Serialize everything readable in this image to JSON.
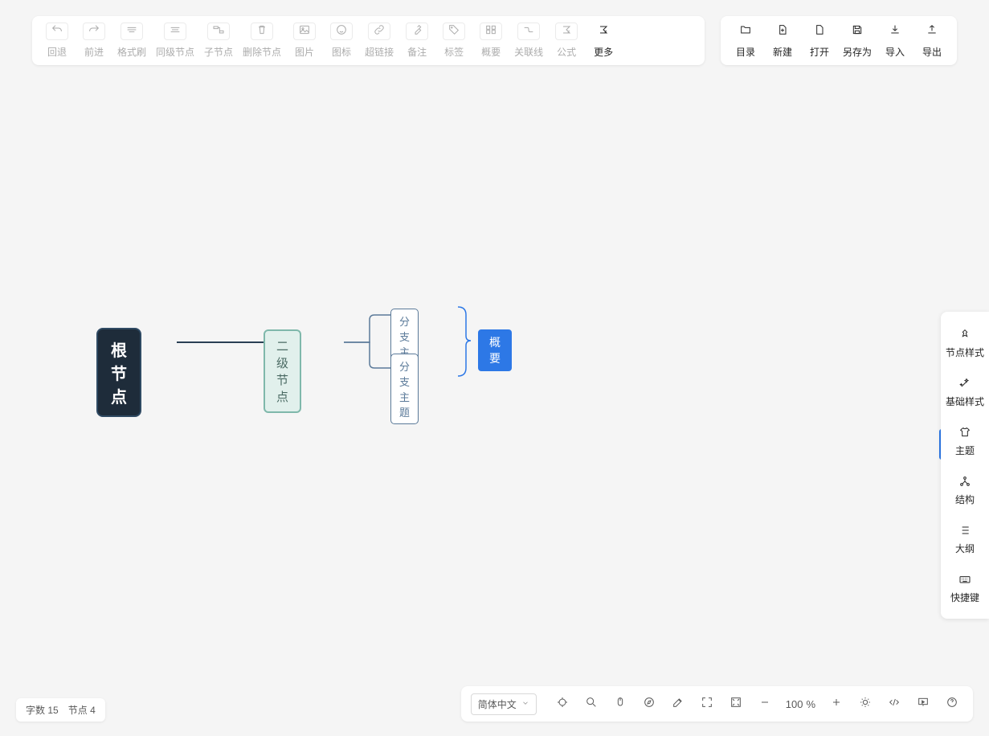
{
  "toolbar": {
    "undo": "回退",
    "redo": "前进",
    "format_painter": "格式刷",
    "sibling_node": "同级节点",
    "child_node": "子节点",
    "delete_node": "删除节点",
    "image": "图片",
    "icon": "图标",
    "hyperlink": "超链接",
    "note": "备注",
    "tag": "标签",
    "summary": "概要",
    "relation": "关联线",
    "formula": "公式",
    "more": "更多"
  },
  "file_toolbar": {
    "catalog": "目录",
    "new": "新建",
    "open": "打开",
    "save_as": "另存为",
    "import": "导入",
    "export": "导出"
  },
  "mindmap": {
    "root": "根节点",
    "level2": "二级节点",
    "branch1": "分支主题",
    "branch2": "分支主题",
    "summary": "概要"
  },
  "side_panel": {
    "node_style": "节点样式",
    "base_style": "基础样式",
    "theme": "主题",
    "structure": "结构",
    "outline": "大纲",
    "shortcut": "快捷键"
  },
  "status": {
    "word_label": "字数",
    "word_count": "15",
    "node_label": "节点",
    "node_count": "4"
  },
  "bottom": {
    "language": "简体中文",
    "zoom_value": "100",
    "zoom_unit": "%"
  }
}
